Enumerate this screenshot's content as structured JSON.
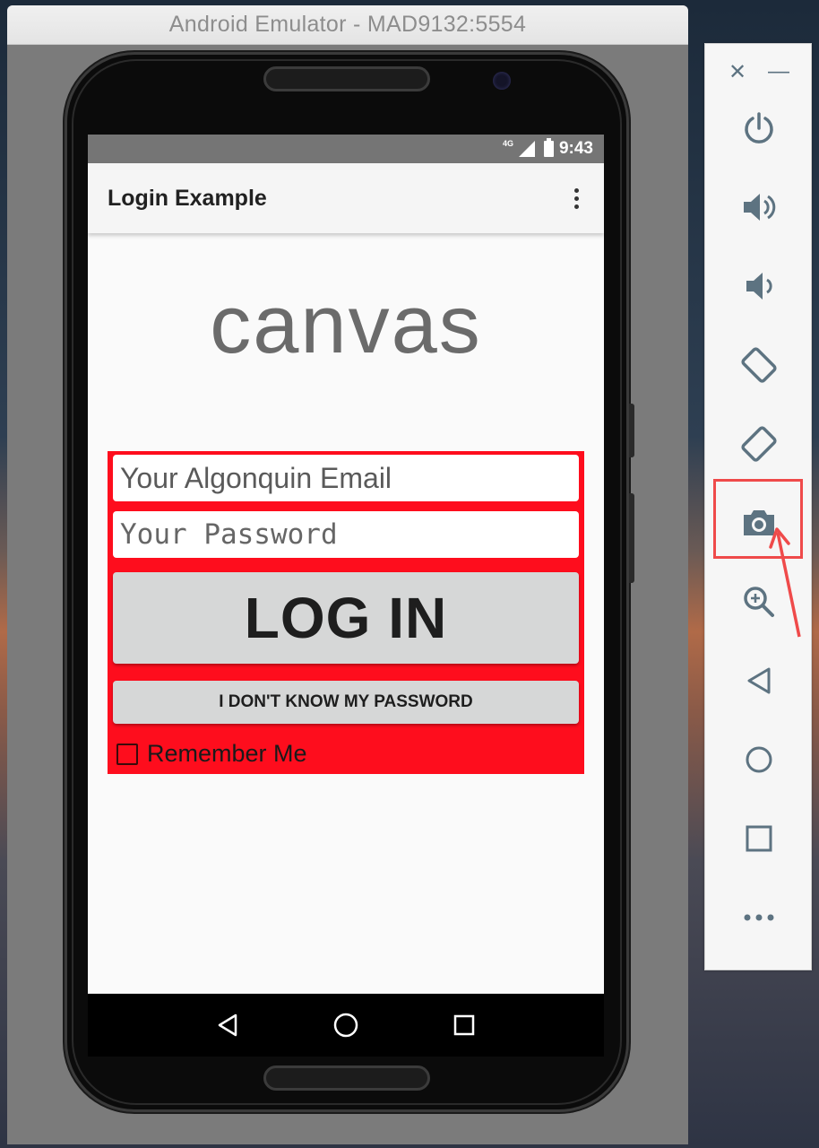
{
  "emulator": {
    "window_title": "Android Emulator - MAD9132:5554"
  },
  "status_bar": {
    "network": "4G",
    "time": "9:43"
  },
  "app_bar": {
    "title": "Login Example",
    "overflow_icon": "more-vertical-icon"
  },
  "logo": {
    "text": "canvas"
  },
  "login_form": {
    "email_placeholder": "Your Algonquin Email",
    "password_placeholder": "Your Password",
    "login_label": "LOG IN",
    "forgot_label": "I DON'T KNOW MY PASSWORD",
    "remember_label": "Remember Me",
    "remember_checked": false,
    "background_color": "#fe0d1d"
  },
  "nav_bar": {
    "back_icon": "back-triangle-icon",
    "home_icon": "home-circle-icon",
    "recents_icon": "recents-square-icon"
  },
  "toolbar": {
    "close_icon": "close-icon",
    "minimize_icon": "minimize-icon",
    "items": [
      {
        "name": "power",
        "icon": "power-icon"
      },
      {
        "name": "volume-up",
        "icon": "volume-up-icon"
      },
      {
        "name": "volume-down",
        "icon": "volume-down-icon"
      },
      {
        "name": "rotate-left",
        "icon": "rotate-left-icon"
      },
      {
        "name": "rotate-right",
        "icon": "rotate-right-icon"
      },
      {
        "name": "screenshot",
        "icon": "camera-icon",
        "highlighted": true
      },
      {
        "name": "zoom",
        "icon": "zoom-in-icon"
      },
      {
        "name": "back",
        "icon": "back-icon"
      },
      {
        "name": "home",
        "icon": "home-icon"
      },
      {
        "name": "overview",
        "icon": "overview-icon"
      },
      {
        "name": "more",
        "icon": "more-horizontal-icon"
      }
    ],
    "icon_color": "#5d7381",
    "highlight_color": "#ef4a4a"
  }
}
